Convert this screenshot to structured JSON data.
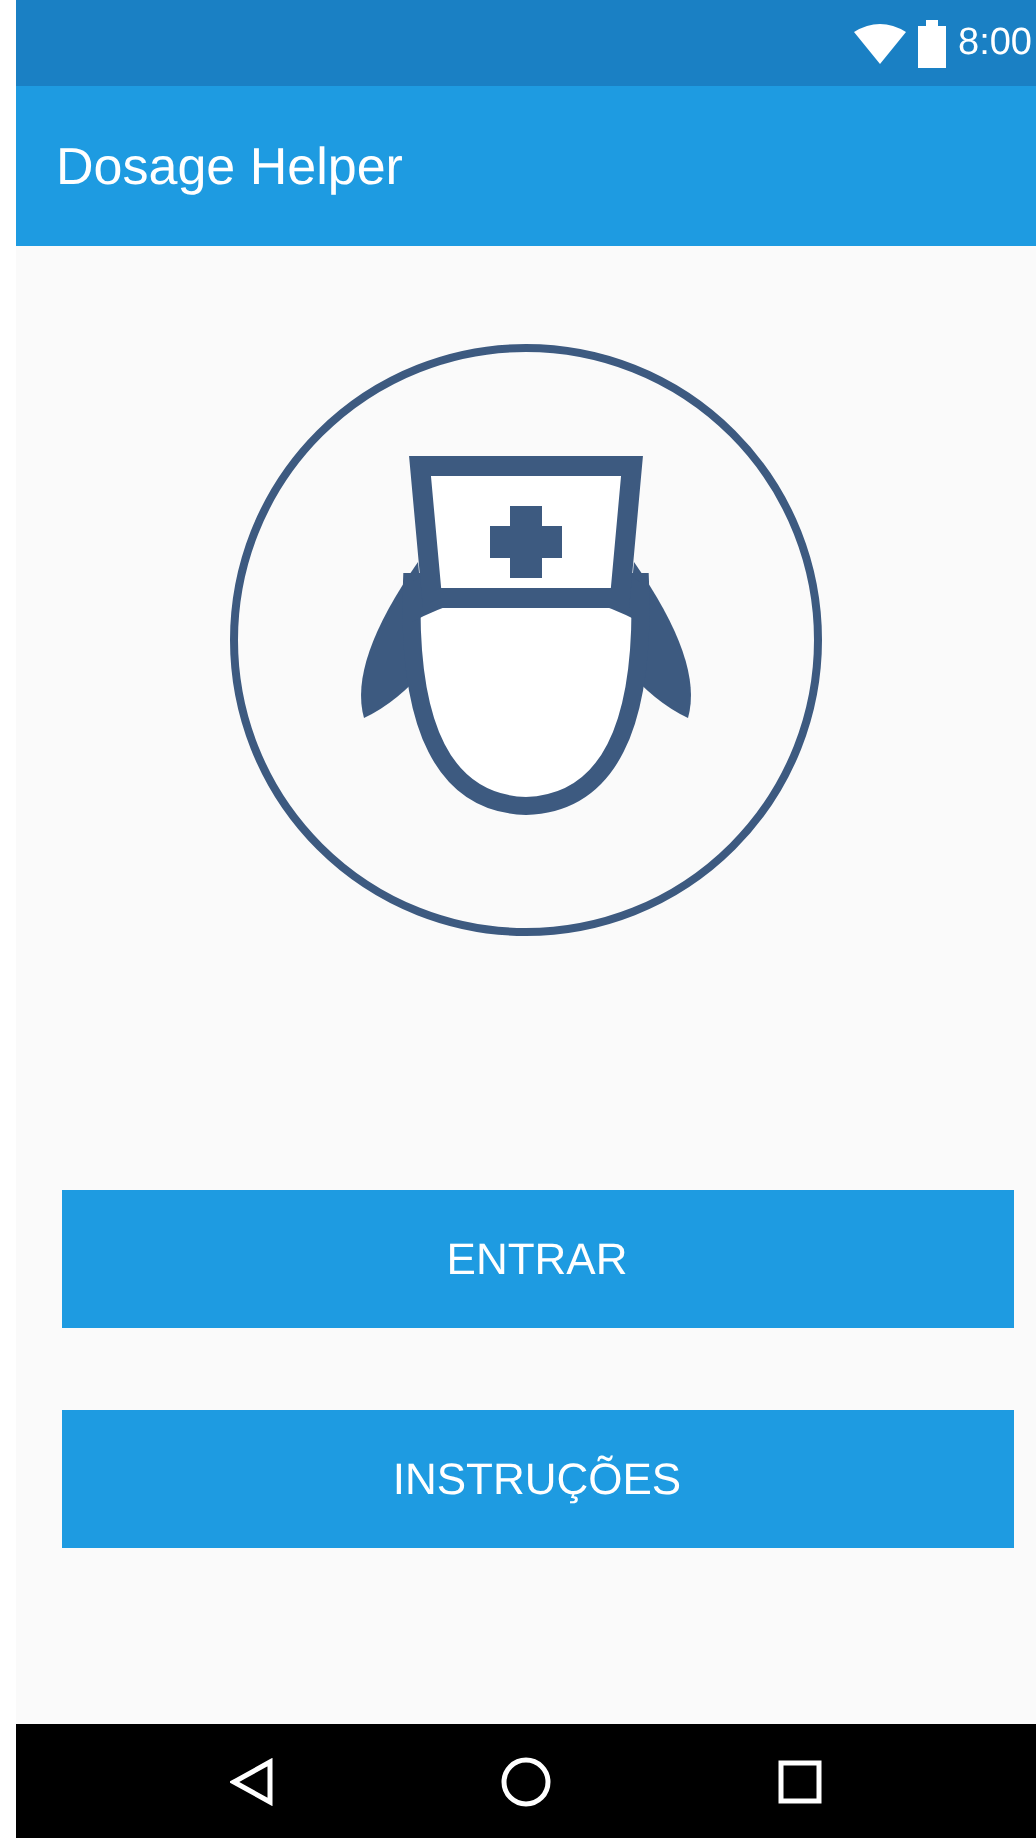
{
  "status_bar": {
    "time": "8:00"
  },
  "app_bar": {
    "title": "Dosage Helper"
  },
  "buttons": [
    {
      "label": "ENTRAR"
    },
    {
      "label": "INSTRUÇÕES"
    }
  ]
}
